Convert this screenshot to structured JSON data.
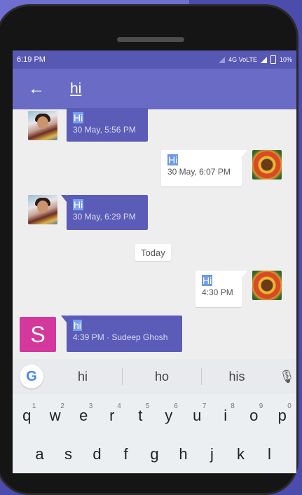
{
  "status_bar": {
    "time": "6:19 PM",
    "network": "4G VoLTE",
    "battery": "10%"
  },
  "toolbar": {
    "search_query": "hi",
    "back_icon": "arrow-left-icon"
  },
  "messages": [
    {
      "direction": "in",
      "text": "Hi",
      "meta": "30 May, 5:56 PM",
      "avatar": "photo-girl"
    },
    {
      "direction": "out",
      "text": "Hi",
      "meta": "30 May, 6:07 PM",
      "avatar": "photo-flower"
    },
    {
      "direction": "in",
      "text": "Hi",
      "meta": "30 May, 6:29 PM",
      "avatar": "photo-girl"
    },
    {
      "direction": "out",
      "text": "Hi",
      "meta": "4:30 PM",
      "avatar": "photo-flower"
    },
    {
      "direction": "in",
      "text": "hi",
      "meta": "4:39 PM · Sudeep Ghosh",
      "avatar": "letter-avatar"
    }
  ],
  "date_divider": "Today",
  "letter_avatar": {
    "letter": "S",
    "color": "#d4389c"
  },
  "suggestions": {
    "logo": "G",
    "items": [
      "hi",
      "ho",
      "his"
    ],
    "mic_icon": "microphone-icon"
  },
  "keyboard": {
    "row1": [
      {
        "k": "q",
        "n": "1"
      },
      {
        "k": "w",
        "n": "2"
      },
      {
        "k": "e",
        "n": "3"
      },
      {
        "k": "r",
        "n": "4"
      },
      {
        "k": "t",
        "n": "5"
      },
      {
        "k": "y",
        "n": "6"
      },
      {
        "k": "u",
        "n": "7"
      },
      {
        "k": "i",
        "n": "8"
      },
      {
        "k": "o",
        "n": "9"
      },
      {
        "k": "p",
        "n": "0"
      }
    ],
    "row2": [
      "a",
      "s",
      "d",
      "f",
      "g",
      "h",
      "j",
      "k",
      "l"
    ]
  },
  "colors": {
    "toolbar": "#6a6bc4",
    "status_bar": "#5658b3",
    "incoming_bubble": "#5b5cb8",
    "outgoing_bubble": "#ffffff"
  }
}
